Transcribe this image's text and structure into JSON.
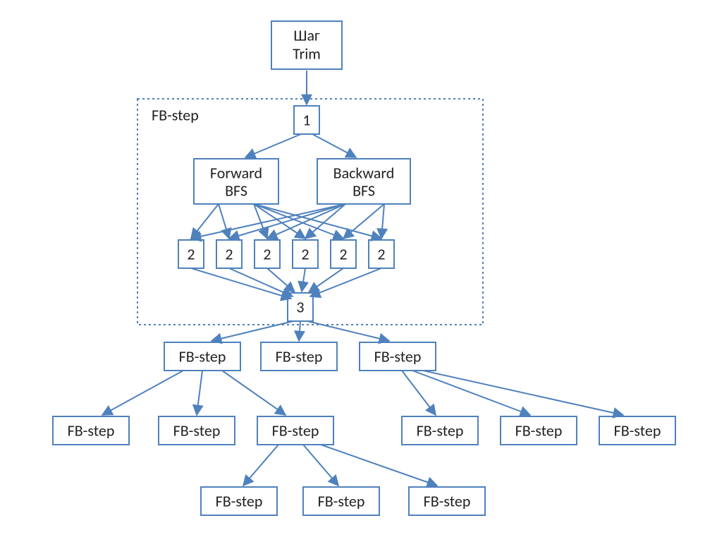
{
  "root": {
    "line1": "Шаг",
    "line2": "Trim"
  },
  "fb_group_label": "FB-step",
  "nodes": {
    "one": "1",
    "fw1": "Forward",
    "fw2": "BFS",
    "bw1": "Backward",
    "bw2": "BFS",
    "twos": [
      "2",
      "2",
      "2",
      "2",
      "2",
      "2"
    ],
    "three": "3",
    "fb_mid": [
      "FB-step",
      "FB-step",
      "FB-step"
    ],
    "fb_row4": [
      "FB-step",
      "FB-step",
      "FB-step",
      "FB-step",
      "FB-step",
      "FB-step"
    ],
    "fb_row5": [
      "FB-step",
      "FB-step",
      "FB-step"
    ]
  },
  "colors": {
    "stroke": "#4f81bd"
  }
}
